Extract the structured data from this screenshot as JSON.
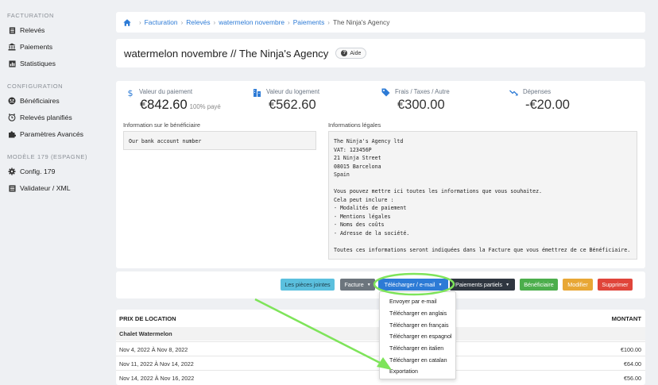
{
  "sidebar": {
    "sections": [
      {
        "title": "FACTURATION",
        "items": [
          {
            "label": "Relevés",
            "icon": "list-icon"
          },
          {
            "label": "Paiements",
            "icon": "bank-icon"
          },
          {
            "label": "Statistiques",
            "icon": "chart-icon"
          }
        ]
      },
      {
        "title": "CONFIGURATION",
        "items": [
          {
            "label": "Bénéficiaires",
            "icon": "users-icon"
          },
          {
            "label": "Relevés planifiés",
            "icon": "clock-icon"
          },
          {
            "label": "Paramètres Avancés",
            "icon": "puzzle-icon"
          }
        ]
      },
      {
        "title": "MODÈLE 179 (ESPAGNE)",
        "items": [
          {
            "label": "Config. 179",
            "icon": "gear-icon"
          },
          {
            "label": "Validateur / XML",
            "icon": "list-icon"
          }
        ]
      }
    ]
  },
  "breadcrumb": {
    "home_icon": "home-icon",
    "items": [
      "Facturation",
      "Relevés",
      "watermelon novembre",
      "Paiements"
    ],
    "current": "The Ninja's Agency"
  },
  "header": {
    "title": "watermelon novembre // The Ninja's Agency",
    "help_label": "Aide"
  },
  "stats": [
    {
      "label": "Valeur du paiement",
      "value": "€842.60",
      "sub": "100% payé",
      "icon": "dollar-icon"
    },
    {
      "label": "Valeur du logement",
      "value": "€562.60",
      "sub": "",
      "icon": "building-icon"
    },
    {
      "label": "Frais / Taxes / Autre",
      "value": "€300.00",
      "sub": "",
      "icon": "tag-icon"
    },
    {
      "label": "Dépenses",
      "value": "-€20.00",
      "sub": "",
      "icon": "trend-down-icon"
    }
  ],
  "beneficiary": {
    "label": "Information sur le bénéficiaire",
    "text": "Our bank account number"
  },
  "legal": {
    "label": "Informations légales",
    "text": "The Ninja's Agency ltd\nVAT: 123456P\n21 Ninja Street\n08015 Barcelona\nSpain\n\nVous pouvez mettre ici toutes les informations que vous souhaitez.\nCela peut inclure :\n- Modalités de paiement\n- Mentions légales\n- Noms des coûts\n- Adresse de la société.\n\nToutes ces informations seront indiquées dans la Facture que vous émettrez de ce Bénéficiaire."
  },
  "toolbar": {
    "attachments": "Les pièces jointes",
    "invoice": "Facture",
    "download": "Télécharger / e-mail",
    "partial": "Paiements partiels",
    "beneficiary": "Bénéficiaire",
    "edit": "Modifier",
    "delete": "Supprimer"
  },
  "dropdown": {
    "items": [
      "Envoyer par e-mail",
      "Télécharger en anglais",
      "Télécharger en français",
      "Télécharger en espagnol",
      "Télécharger en italien",
      "Télécharger en catalan",
      "Exportation"
    ]
  },
  "table": {
    "col_left": "PRIX DE LOCATION",
    "col_right": "MONTANT",
    "group": "Chalet Watermelon",
    "rows": [
      {
        "dates": "Nov 4, 2022 À Nov 8, 2022",
        "amount": "€100.00"
      },
      {
        "dates": "Nov 11, 2022 À Nov 14, 2022",
        "amount": "€64.00"
      },
      {
        "dates": "Nov 14, 2022 À Nov 16, 2022",
        "amount": "€56.00"
      }
    ]
  },
  "colors": {
    "accent_blue": "#2d7bd6",
    "btn_attachments": "#5bc0de",
    "btn_invoice": "#6c757d",
    "btn_download": "#2d7bd6",
    "btn_partial": "#2f3640",
    "btn_beneficiary": "#4cae4c",
    "btn_edit": "#e8a735",
    "btn_delete": "#e0453a",
    "annotation_green": "#7ee45a"
  }
}
